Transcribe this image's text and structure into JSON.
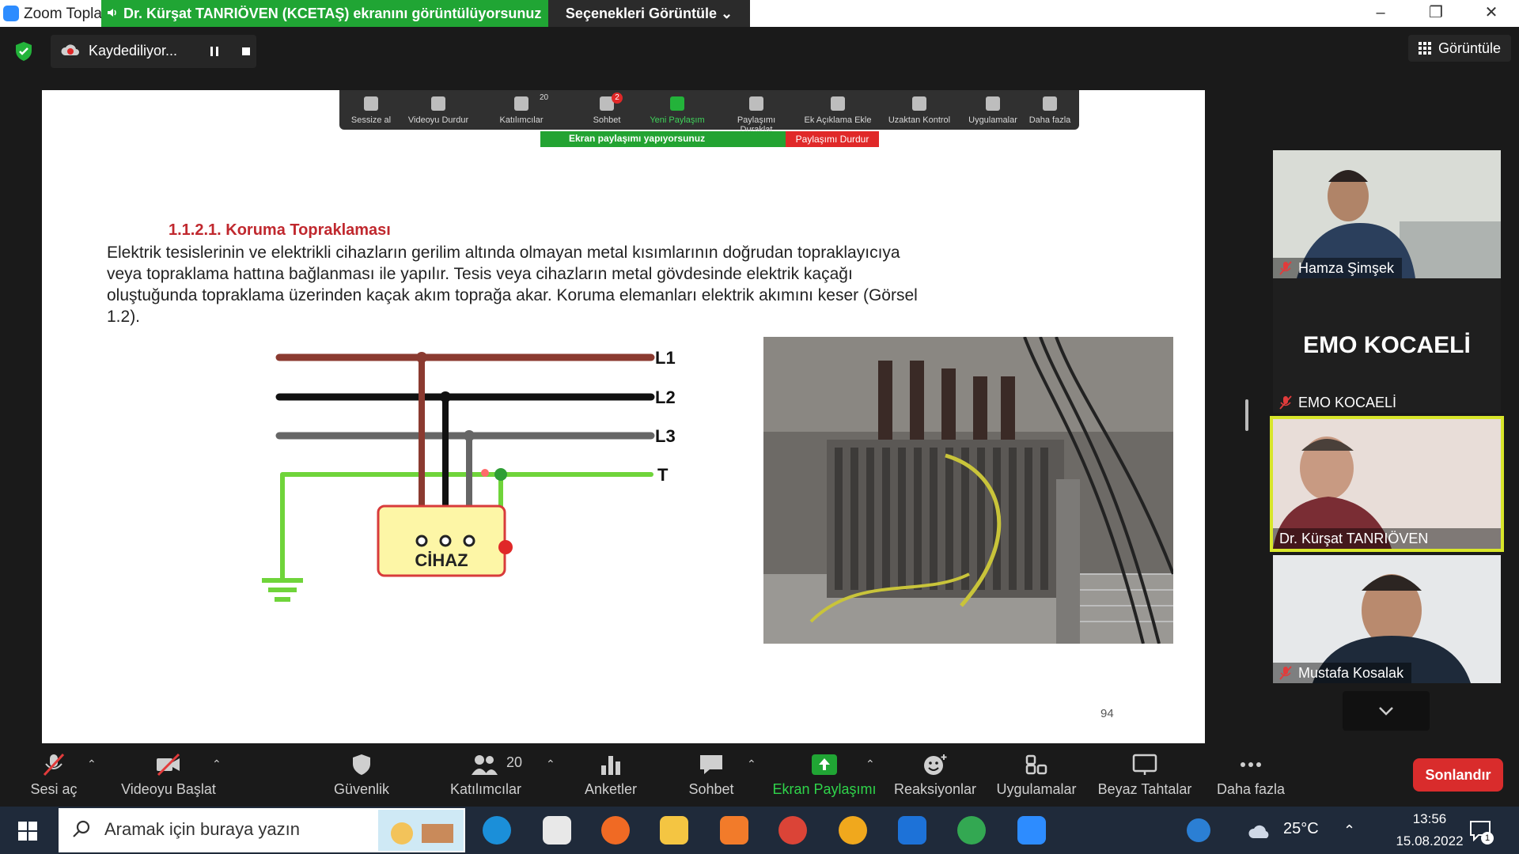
{
  "window": {
    "app_title": "Zoom Topla",
    "share_banner": "Dr. Kürşat TANRIÖVEN (KCETAŞ) ekranını görüntülüyorsunuz",
    "view_options": "Seçenekleri Görüntüle ⌄",
    "controls": [
      "–",
      "❐",
      "✕"
    ]
  },
  "top_bar": {
    "recording_label": "Kaydediliyor...",
    "view_button": "Görüntüle"
  },
  "shared_toolbar": {
    "items": [
      "Sessize al",
      "Videoyu Durdur",
      "Katılımcılar",
      "Sohbet",
      "Yeni Paylaşım",
      "Paylaşımı Duraklat",
      "Ek Açıklama Ekle",
      "Uzaktan Kontrol",
      "Uygulamalar",
      "Daha fazla"
    ],
    "participant_count": "20",
    "chat_badge": "2",
    "share_banner": "Ekran paylaşımı yapıyorsunuz",
    "stop_share": "Paylaşımı Durdur"
  },
  "document": {
    "heading": "1.1.2.1. Koruma Topraklaması",
    "paragraph": "Elektrik tesislerinin ve elektrikli cihazların gerilim altında olmayan metal kısımlarının doğrudan topraklayıcıya veya topraklama hattına bağlanması ile yapılır. Tesis veya cihazların metal gövdesinde elektrik kaçağı oluştuğunda topraklama üzerinden kaçak akım toprağa akar. Koruma elemanları elektrik akımını keser (Görsel 1.2).",
    "diagram_labels": [
      "L1",
      "L2",
      "L3",
      "T"
    ],
    "device_label": "CİHAZ",
    "page_number": "94"
  },
  "gallery": {
    "participants": [
      {
        "name": "Hamza Şimşek"
      },
      {
        "name": "EMO KOCAELİ",
        "display": "EMO KOCAELİ"
      },
      {
        "name": "Dr. Kürşat TANRIÖVEN (KCETAŞ)"
      },
      {
        "name": "Mustafa Kosalak"
      }
    ]
  },
  "toolbar": {
    "unmute": "Sesi aç",
    "start_video": "Videoyu Başlat",
    "security": "Güvenlik",
    "participants": "Katılımcılar",
    "participants_count": "20",
    "polls": "Anketler",
    "chat": "Sohbet",
    "share_screen": "Ekran Paylaşımı",
    "reactions": "Reaksiyonlar",
    "apps": "Uygulamalar",
    "whiteboards": "Beyaz Tahtalar",
    "more": "Daha fazla",
    "end": "Sonlandır"
  },
  "taskbar": {
    "search_placeholder": "Aramak için buraya yazın",
    "temperature": "25°C",
    "time": "13:56",
    "date": "15.08.2022",
    "notification_count": "1"
  },
  "colors": {
    "share_green": "#20a534",
    "end_red": "#d92c2c",
    "active_speaker": "#d8e62a",
    "heading_red": "#c0282e"
  }
}
